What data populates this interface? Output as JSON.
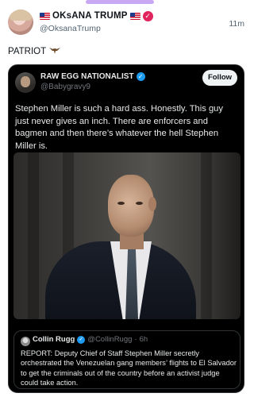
{
  "post": {
    "author_name": "OKsANA TRUMP",
    "handle": "@OksanaTrump",
    "time": "11m",
    "text": "PATRIOT",
    "flag_icon": "us-flag-icon",
    "badge_icon": "pink-verified-check-icon",
    "eagle_icon": "eagle-icon"
  },
  "quoted": {
    "author_name": "RAW EGG NATIONALIST",
    "handle": "@Babygravy9",
    "follow_label": "Follow",
    "badge_icon": "blue-verified-check-icon",
    "text": "Stephen Miller is such a hard ass. Honestly. This guy just never gives an inch. There are enforcers and bagmen and then there’s whatever the hell Stephen Miller is.",
    "photo_alt": "photo"
  },
  "nested": {
    "author_name": "Collin Rugg",
    "handle": "@CollinRugg",
    "separator": "·",
    "time": "6h",
    "text": "REPORT: Deputy Chief of Staff Stephen Miller secretly orchestrated the Venezuelan gang members’ flights to El Salvador to get the criminals out of the country before an activist judge could take action."
  },
  "colors": {
    "accent_blue": "#1d9bf0",
    "badge_pink": "#e0245e",
    "card_bg": "#000000",
    "text_secondary": "#536471"
  }
}
